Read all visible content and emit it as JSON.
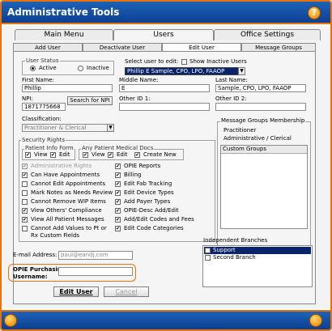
{
  "window": {
    "title": "Administrative Tools",
    "help": "?"
  },
  "main_tabs": [
    "Main Menu",
    "Users",
    "Office Settings"
  ],
  "sub_tabs": [
    "Add User",
    "Deactivate User",
    "Edit User",
    "Message Groups"
  ],
  "user_status": {
    "legend": "User Status",
    "active": "Active",
    "inactive": "Inactive"
  },
  "select_user": {
    "label": "Select user to edit:",
    "value": "Phillip E Sample, CPO, LPO, FAAOP",
    "show_inactive": "Show Inactive Users"
  },
  "form": {
    "first_name_label": "First Name:",
    "first_name": "Phillip",
    "middle_name_label": "Middle Name:",
    "middle_name": "E",
    "last_name_label": "Last Name:",
    "last_name": "Sample, CPO, LPO, FAAOP",
    "npi_label": "NPI:",
    "npi": "1871775668",
    "search_npi": "Search for NPI",
    "other_id1_label": "Other ID 1:",
    "other_id1": "",
    "other_id2_label": "Other ID 2:",
    "other_id2": "",
    "classification_label": "Classification:",
    "classification": "Practitioner & Clerical"
  },
  "message_groups": {
    "title": "Message Groups Membership",
    "line1": "Practitioner",
    "line2": "Administrative / Clerical",
    "custom_groups": "Custom Groups"
  },
  "security": {
    "legend": "Security Rights",
    "patient_info_legend": "Patient Info Form",
    "view": "View",
    "edit": "Edit",
    "medical_docs_legend": "Any Patient Medical Docs",
    "create_new": "Create New",
    "left": [
      {
        "label": "Administrative Rights",
        "checked": true,
        "disabled": true
      },
      {
        "label": "Can Have Appointments",
        "checked": true,
        "disabled": false
      },
      {
        "label": "Cannot Edit Appointments",
        "checked": false,
        "disabled": false
      },
      {
        "label": "Mark Notes as Needs Review",
        "checked": false,
        "disabled": false
      },
      {
        "label": "Cannot Remove WIP Items",
        "checked": false,
        "disabled": false
      },
      {
        "label": "View Others' Compliance",
        "checked": true,
        "disabled": false
      },
      {
        "label": "View All Patient Messages",
        "checked": true,
        "disabled": false
      },
      {
        "label": "Cannot Add Values to Pt or",
        "label2": "Rx Custom Fields",
        "checked": false,
        "disabled": false
      }
    ],
    "right": [
      {
        "label": "OPIE Reports",
        "checked": true
      },
      {
        "label": "Billing",
        "checked": true
      },
      {
        "label": "Edit Fab Tracking",
        "checked": true
      },
      {
        "label": "Edit Device Types",
        "checked": true
      },
      {
        "label": "Add Payer Types",
        "checked": true
      },
      {
        "label": "OPIE-Desc Add/Edit",
        "checked": true
      },
      {
        "label": "Add/Edit Codes and Fees",
        "checked": true
      },
      {
        "label": "Edit Code Categories",
        "checked": true
      }
    ]
  },
  "email": {
    "label": "E-mail Address:",
    "value": "paul@eandj.com"
  },
  "opie": {
    "label1": "OPIE Purchasing",
    "label2": "Username:",
    "value": ""
  },
  "branches": {
    "title": "Independent Branches",
    "items": [
      {
        "label": "Support",
        "selected": true
      },
      {
        "label": "Second Branch",
        "selected": false
      }
    ]
  },
  "buttons": {
    "edit": "Edit User",
    "cancel": "Cancel"
  },
  "colors": {
    "accent": "#e8730a",
    "brand": "#0b3f92",
    "selection": "#0a246a"
  }
}
